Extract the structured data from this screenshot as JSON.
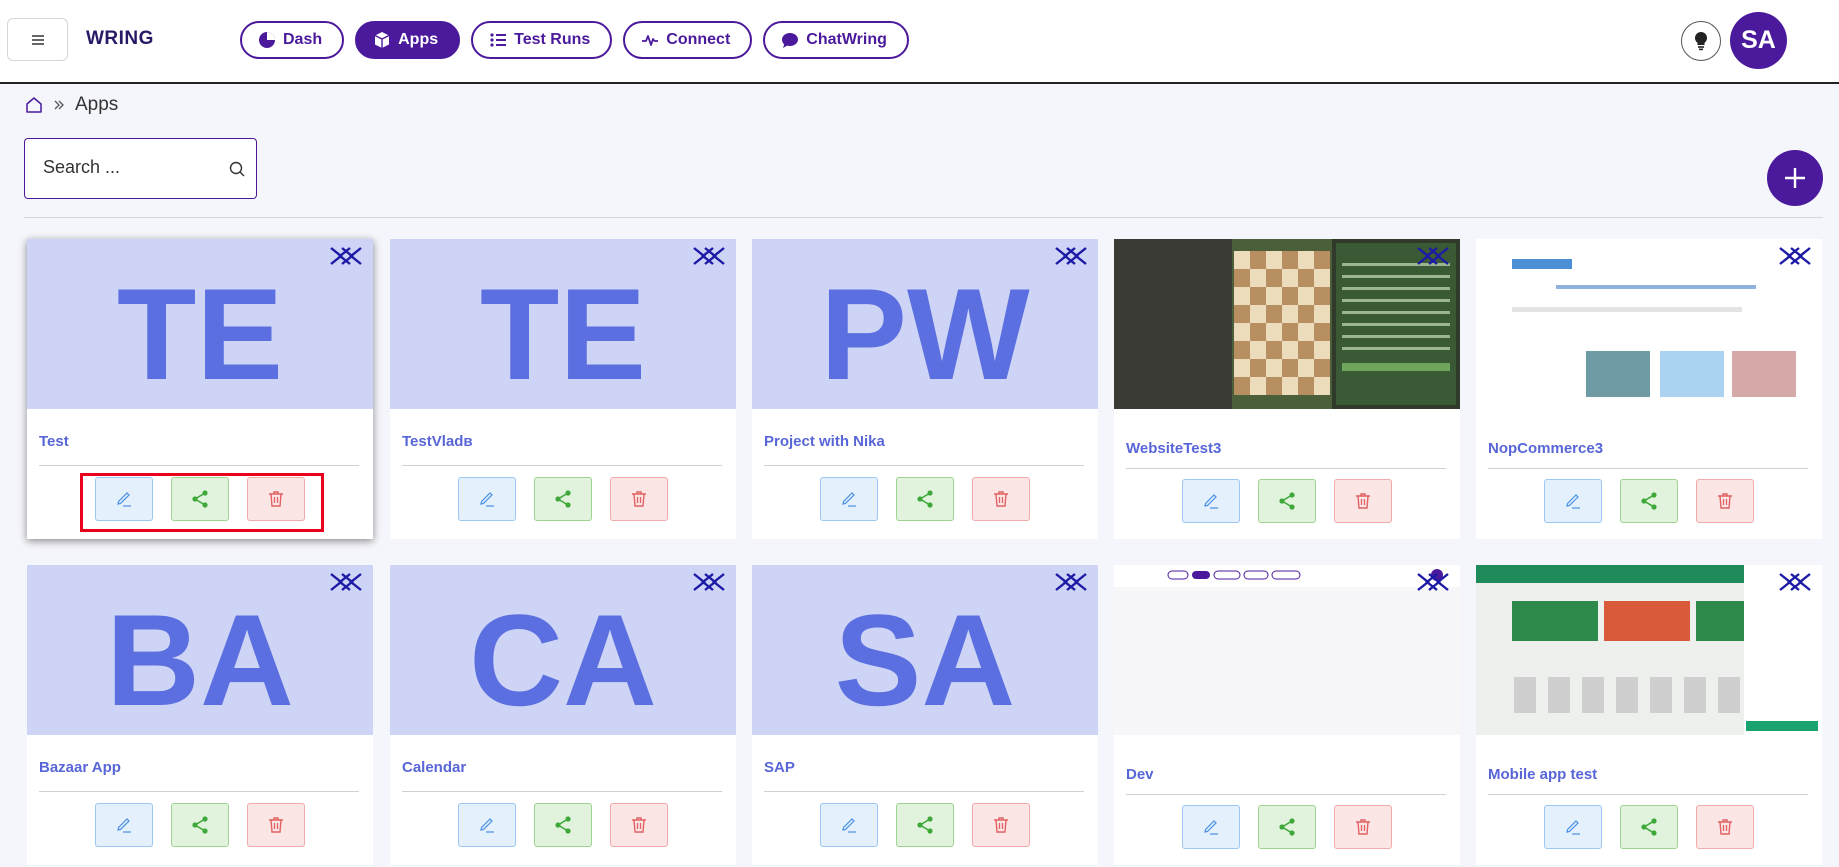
{
  "header": {
    "brand": "WRING",
    "nav": [
      {
        "label": "Dash",
        "icon": "pie-chart-icon",
        "active": false
      },
      {
        "label": "Apps",
        "icon": "cube-icon",
        "active": true
      },
      {
        "label": "Test Runs",
        "icon": "list-icon",
        "active": false
      },
      {
        "label": "Connect",
        "icon": "pulse-icon",
        "active": false
      },
      {
        "label": "ChatWring",
        "icon": "chat-bubble-icon",
        "active": false
      }
    ],
    "avatar_initials": "SA"
  },
  "breadcrumb": {
    "current": "Apps"
  },
  "search": {
    "placeholder": "Search ..."
  },
  "apps": [
    {
      "title": "Test",
      "initials": "TE",
      "thumb": "initials"
    },
    {
      "title": "TestVladв",
      "initials": "TE",
      "thumb": "initials"
    },
    {
      "title": "Project with Nika",
      "initials": "PW",
      "thumb": "initials"
    },
    {
      "title": "WebsiteTest3",
      "initials": "",
      "thumb": "screenshot-chess"
    },
    {
      "title": "NopCommerce3",
      "initials": "",
      "thumb": "screenshot-shop"
    },
    {
      "title": "Bazaar App",
      "initials": "BA",
      "thumb": "initials"
    },
    {
      "title": "Calendar",
      "initials": "CA",
      "thumb": "initials"
    },
    {
      "title": "SAP",
      "initials": "SA",
      "thumb": "initials"
    },
    {
      "title": "Dev",
      "initials": "",
      "thumb": "screenshot-blank"
    },
    {
      "title": "Mobile app test",
      "initials": "",
      "thumb": "screenshot-store"
    }
  ],
  "colors": {
    "accent": "#4b1a9c",
    "card_title": "#5866d8",
    "initials": "#5b6fe0",
    "thumb_bg": "#cdd4f6",
    "highlight": "#e8001c"
  }
}
